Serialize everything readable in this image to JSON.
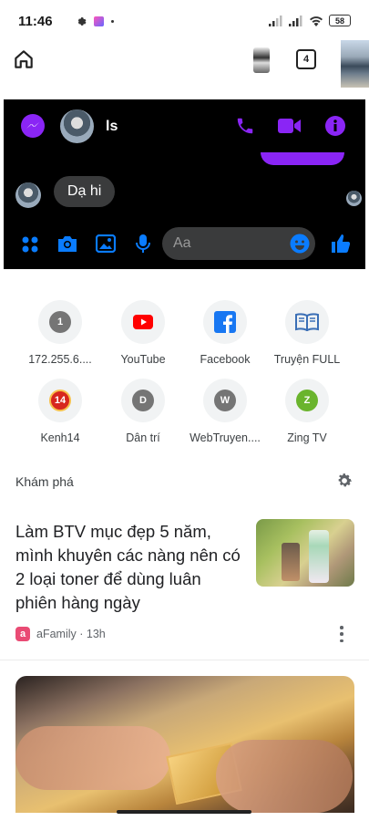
{
  "status_bar": {
    "time": "11:46",
    "battery": "58"
  },
  "toolbar": {
    "tab_count": "4"
  },
  "messenger": {
    "contact_name": "ls",
    "incoming_message": "Dạ hi",
    "input_placeholder": "Aa",
    "accent_color": "#8a25f5",
    "icon_color": "#0a7cff"
  },
  "shortcuts": [
    {
      "label": "172.255.6....",
      "letter": "1",
      "color": "#757575"
    },
    {
      "label": "YouTube",
      "icon": "youtube-icon"
    },
    {
      "label": "Facebook",
      "icon": "facebook-icon"
    },
    {
      "label": "Truyện FULL",
      "icon": "book-icon"
    },
    {
      "label": "Kenh14",
      "letter": "14",
      "color": "#d7261e"
    },
    {
      "label": "Dân trí",
      "letter": "D",
      "color": "#757575"
    },
    {
      "label": "WebTruyen....",
      "letter": "W",
      "color": "#757575"
    },
    {
      "label": "Zing TV",
      "letter": "Z",
      "color": "#6ab42d"
    }
  ],
  "discover": {
    "title": "Khám phá",
    "article": {
      "title": "Làm BTV mục đẹp 5 năm, mình khuyên các nàng nên có 2 loại toner để dùng luân phiên hàng ngày",
      "source": "aFamily",
      "time": "13h",
      "meta": "aFamily · 13h"
    }
  }
}
